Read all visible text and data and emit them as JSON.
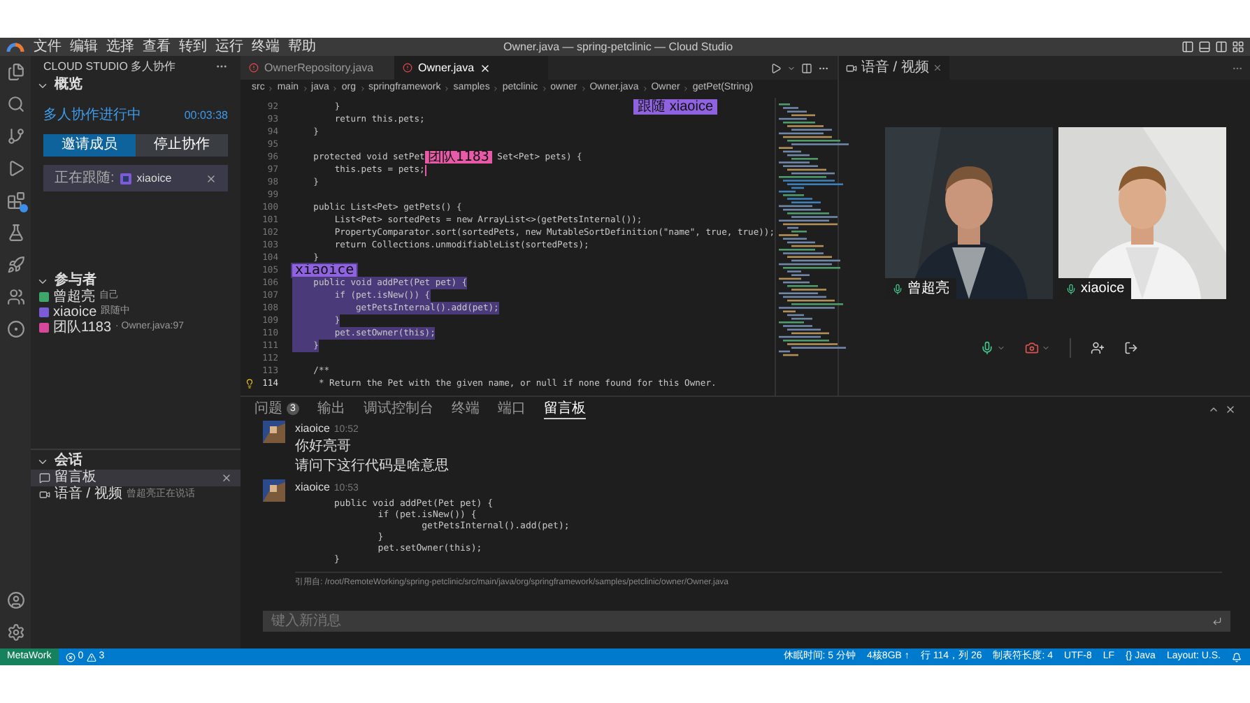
{
  "menu": [
    "文件",
    "编辑",
    "选择",
    "查看",
    "转到",
    "运行",
    "终端",
    "帮助"
  ],
  "window_title": "Owner.java — spring-petclinic — Cloud Studio",
  "sidebar": {
    "title": "CLOUD STUDIO 多人协作",
    "overview": {
      "heading": "概览",
      "expanded": true,
      "status": "多人协作进行中",
      "timer": "00:03:38",
      "buttons": [
        {
          "label": "邀请成员",
          "kind": "primary"
        },
        {
          "label": "停止协作",
          "kind": "secondary"
        }
      ],
      "following_label": "正在跟随:",
      "following_user": "xiaoice"
    },
    "participants": {
      "heading": "参与者",
      "expanded": true,
      "items": [
        {
          "name": "曾超亮",
          "note": "自己",
          "color": "#3fa66b"
        },
        {
          "name": "xiaoice",
          "note": "跟随中",
          "color": "#7c5cd6"
        },
        {
          "name": "团队1183",
          "note": "· Owner.java:97",
          "color": "#d6489a"
        }
      ]
    },
    "sessions": {
      "heading": "会话",
      "expanded": true,
      "items": [
        {
          "kind": "board",
          "label": "留言板",
          "selected": true
        },
        {
          "kind": "video",
          "label": "语音 / 视频",
          "note": "曾超亮正在说话",
          "selected": false
        }
      ]
    }
  },
  "editor": {
    "tabs": [
      {
        "label": "OwnerRepository.java",
        "selected": false
      },
      {
        "label": "Owner.java",
        "selected": true
      }
    ],
    "breadcrumb": [
      "src",
      "main",
      "java",
      "org",
      "springframework",
      "samples",
      "petclinic",
      "owner",
      "Owner.java",
      "Owner",
      "getPet(String)"
    ],
    "follow_badge": "跟随 xiaoice",
    "lines": [
      {
        "number": "92",
        "code": "        }",
        "highlighted": false
      },
      {
        "number": "93",
        "code": "        return this.pets;",
        "highlighted": false
      },
      {
        "number": "94",
        "code": "    }",
        "highlighted": false
      },
      {
        "number": "95"
      },
      {
        "number": "96",
        "code": "    protected void setPet",
        "tag": "团队1183",
        "color": "#e85aa8",
        "code_after": " Set<Pet> pets) {",
        "highlighted": false
      },
      {
        "number": "97",
        "code": "        this.pets = pets;",
        "cursor": true,
        "highlighted": false
      },
      {
        "number": "98",
        "code": "    }",
        "highlighted": false
      },
      {
        "number": "99"
      },
      {
        "number": "100",
        "code": "    public List<Pet> getPets() {",
        "highlighted": false
      },
      {
        "number": "101",
        "code": "        List<Pet> sortedPets = new ArrayList<>(getPetsInternal());",
        "highlighted": false
      },
      {
        "number": "102",
        "code": "        PropertyComparator.sort(sortedPets, new MutableSortDefinition(\"name\", true, true));",
        "highlighted": false
      },
      {
        "number": "103",
        "code": "        return Collections.unmodifiableList(sortedPets);",
        "highlighted": false
      },
      {
        "number": "104",
        "code": "    }",
        "highlighted": false
      },
      {
        "number": "105",
        "tag": "xiaoice",
        "color": "#8f62e0",
        "highlighted": true
      },
      {
        "number": "106",
        "code": "    public void addPet(Pet pet) {",
        "highlighted": true
      },
      {
        "number": "107",
        "code": "        if (pet.isNew()) {",
        "highlighted": true
      },
      {
        "number": "108",
        "code": "            getPetsInternal().add(pet);",
        "highlighted": true
      },
      {
        "number": "109",
        "code": "        }",
        "highlighted": true
      },
      {
        "number": "110",
        "code": "        pet.setOwner(this);",
        "highlighted": true
      },
      {
        "number": "111",
        "code": "    }",
        "highlighted": true
      },
      {
        "number": "112"
      },
      {
        "number": "113",
        "code": "    /**",
        "highlighted": false
      },
      {
        "number": "114",
        "code": "     * Return the Pet with the given name, or null if none found for this Owner.",
        "hint": true,
        "highlighted": false
      }
    ]
  },
  "video": {
    "tab": "语音 / 视频",
    "participants": [
      {
        "name": "曾超亮",
        "mic_on": true
      },
      {
        "name": "xiaoice",
        "mic_on": true
      }
    ],
    "mic_on": true,
    "camera_on": false
  },
  "panel": {
    "tabs": [
      {
        "label": "问题",
        "count": "3",
        "selected": false
      },
      {
        "label": "输出",
        "selected": false
      },
      {
        "label": "调试控制台",
        "selected": false
      },
      {
        "label": "终端",
        "selected": false
      },
      {
        "label": "端口",
        "selected": false
      },
      {
        "label": "留言板",
        "selected": true
      }
    ],
    "messages": [
      {
        "author": "xiaoice",
        "time": "10:52",
        "texts": [
          "你好亮哥",
          "请问下这行代码是啥意思"
        ]
      },
      {
        "author": "xiaoice",
        "time": "10:53",
        "code": [
          "public void addPet(Pet pet) {",
          "        if (pet.isNew()) {",
          "                getPetsInternal().add(pet);",
          "        }",
          "        pet.setOwner(this);",
          "}"
        ],
        "quote": "引用自: /root/RemoteWorking/spring-petclinic/src/main/java/org/springframework/samples/petclinic/owner/Owner.java"
      }
    ],
    "input_placeholder": "键入新消息"
  },
  "status_bar": {
    "remote": "MetaWork",
    "errors": "0",
    "warnings": "3",
    "items": [
      "休眠时间: 5 分钟",
      "4核8GB ↑",
      "行 114，列 26",
      "制表符长度: 4",
      "UTF-8",
      "LF",
      "{} Java",
      "Layout: U.S."
    ]
  }
}
